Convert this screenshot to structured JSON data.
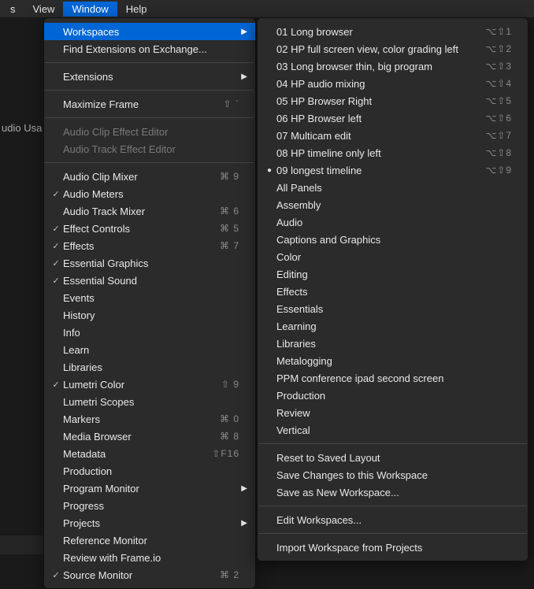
{
  "menubar": {
    "s": "s",
    "view": "View",
    "window": "Window",
    "help": "Help"
  },
  "bgLabel": "udio Usa",
  "mainMenu": {
    "workspaces": "Workspaces",
    "findExtensions": "Find Extensions on Exchange...",
    "extensions": "Extensions",
    "maximizeFrame": "Maximize Frame",
    "maximizeFrameSc": "⇧ `",
    "audioClipEffectEditor": "Audio Clip Effect Editor",
    "audioTrackEffectEditor": "Audio Track Effect Editor",
    "audioClipMixer": "Audio Clip Mixer",
    "audioClipMixerSc": "⌘ 9",
    "audioMeters": "Audio Meters",
    "audioTrackMixer": "Audio Track Mixer",
    "audioTrackMixerSc": "⌘ 6",
    "effectControls": "Effect Controls",
    "effectControlsSc": "⌘ 5",
    "effects": "Effects",
    "effectsSc": "⌘ 7",
    "essentialGraphics": "Essential Graphics",
    "essentialSound": "Essential Sound",
    "events": "Events",
    "history": "History",
    "info": "Info",
    "learn": "Learn",
    "libraries": "Libraries",
    "lumetriColor": "Lumetri Color",
    "lumetriColorSc": "⇧ 9",
    "lumetriScopes": "Lumetri Scopes",
    "markers": "Markers",
    "markersSc": "⌘ 0",
    "mediaBrowser": "Media Browser",
    "mediaBrowserSc": "⌘ 8",
    "metadata": "Metadata",
    "metadataSc": "⇧F16",
    "production": "Production",
    "programMonitor": "Program Monitor",
    "progress": "Progress",
    "projects": "Projects",
    "referenceMonitor": "Reference Monitor",
    "reviewFrameio": "Review with Frame.io",
    "sourceMonitor": "Source Monitor",
    "sourceMonitorSc": "⌘ 2"
  },
  "submenu": {
    "ws01": "01 Long browser",
    "ws01Sc": "⌥⇧1",
    "ws02": "02 HP full screen view, color grading left",
    "ws02Sc": "⌥⇧2",
    "ws03": "03 Long browser thin, big program",
    "ws03Sc": "⌥⇧3",
    "ws04": "04 HP audio mixing",
    "ws04Sc": "⌥⇧4",
    "ws05": "05 HP Browser Right",
    "ws05Sc": "⌥⇧5",
    "ws06": "06 HP Browser left",
    "ws06Sc": "⌥⇧6",
    "ws07": "07 Multicam edit",
    "ws07Sc": "⌥⇧7",
    "ws08": "08 HP timeline only left",
    "ws08Sc": "⌥⇧8",
    "ws09": "09 longest timeline",
    "ws09Sc": "⌥⇧9",
    "allPanels": "All Panels",
    "assembly": "Assembly",
    "audio": "Audio",
    "captions": "Captions and Graphics",
    "color": "Color",
    "editing": "Editing",
    "effects": "Effects",
    "essentials": "Essentials",
    "learning": "Learning",
    "libraries": "Libraries",
    "metalogging": "Metalogging",
    "ppm": "PPM conference ipad second screen",
    "production": "Production",
    "review": "Review",
    "vertical": "Vertical",
    "reset": "Reset to Saved Layout",
    "saveChanges": "Save Changes to this Workspace",
    "saveAs": "Save as New Workspace...",
    "edit": "Edit Workspaces...",
    "import": "Import Workspace from Projects"
  }
}
